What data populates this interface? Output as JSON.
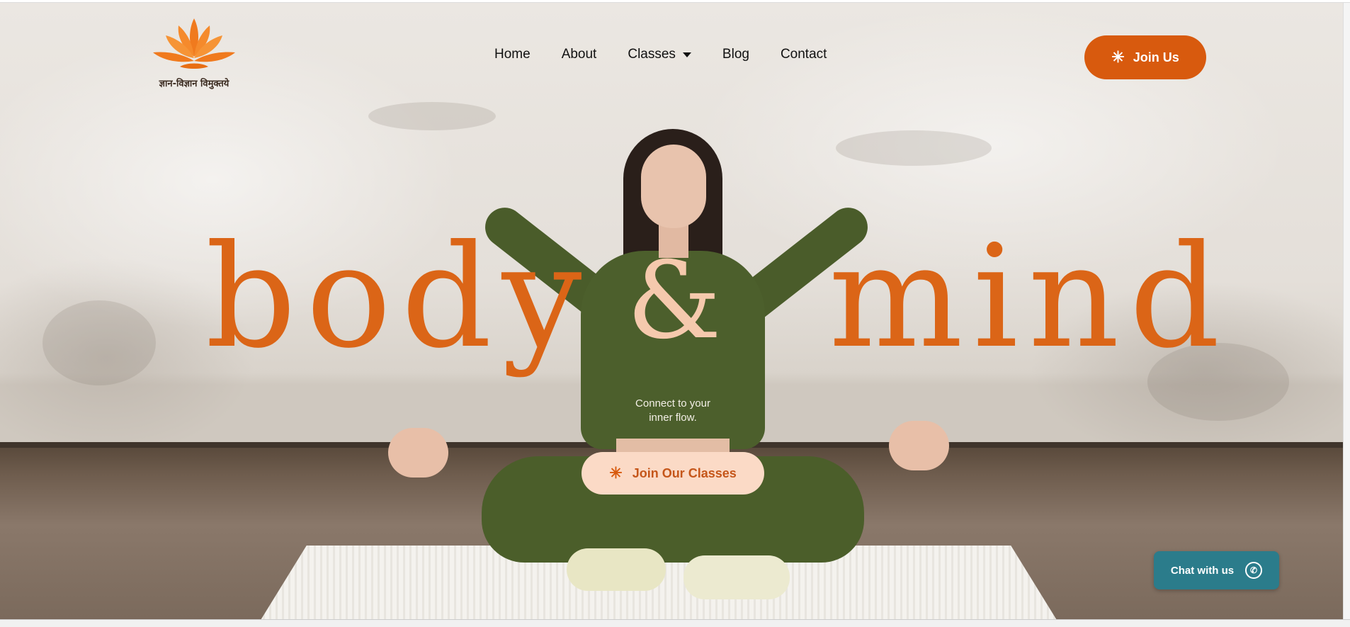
{
  "brand": {
    "logo_icon": "lotus-icon",
    "tagline_devanagari": "ज्ञान-विज्ञान विमुक्तये",
    "accent_color": "#d85a0e"
  },
  "nav": {
    "items": [
      {
        "label": "Home"
      },
      {
        "label": "About"
      },
      {
        "label": "Classes",
        "has_dropdown": true
      },
      {
        "label": "Blog"
      },
      {
        "label": "Contact"
      }
    ]
  },
  "header": {
    "join_label": "Join Us",
    "join_icon": "sparkle-icon"
  },
  "hero": {
    "word_left": "body",
    "word_amp": "&",
    "word_right": "mind",
    "tagline": "Connect to your inner flow.",
    "cta_label": "Join Our Classes",
    "cta_icon": "sparkle-icon"
  },
  "chat": {
    "label": "Chat with us",
    "icon": "whatsapp-icon",
    "color": "#2b7c8b"
  }
}
